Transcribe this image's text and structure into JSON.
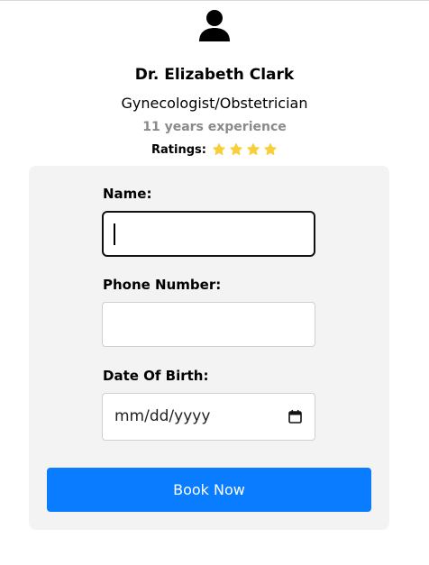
{
  "doctor": {
    "name": "Dr. Elizabeth Clark",
    "specialty": "Gynecologist/Obstetrician",
    "experience": "11 years experience",
    "ratings_label": "Ratings:",
    "rating_stars": 4,
    "star_color": "#f7cf3a"
  },
  "form": {
    "name_label": "Name:",
    "name_value": "",
    "phone_label": "Phone Number:",
    "phone_value": "",
    "dob_label": "Date Of Birth:",
    "dob_placeholder": "mm/dd/yyyy",
    "book_button_label": "Book Now"
  },
  "colors": {
    "accent": "#0a7cff",
    "card_background": "#f3f3f3",
    "muted_text": "#8a8a8a"
  },
  "icons": {
    "avatar": "user-icon",
    "star": "star-icon",
    "calendar": "calendar-icon"
  }
}
